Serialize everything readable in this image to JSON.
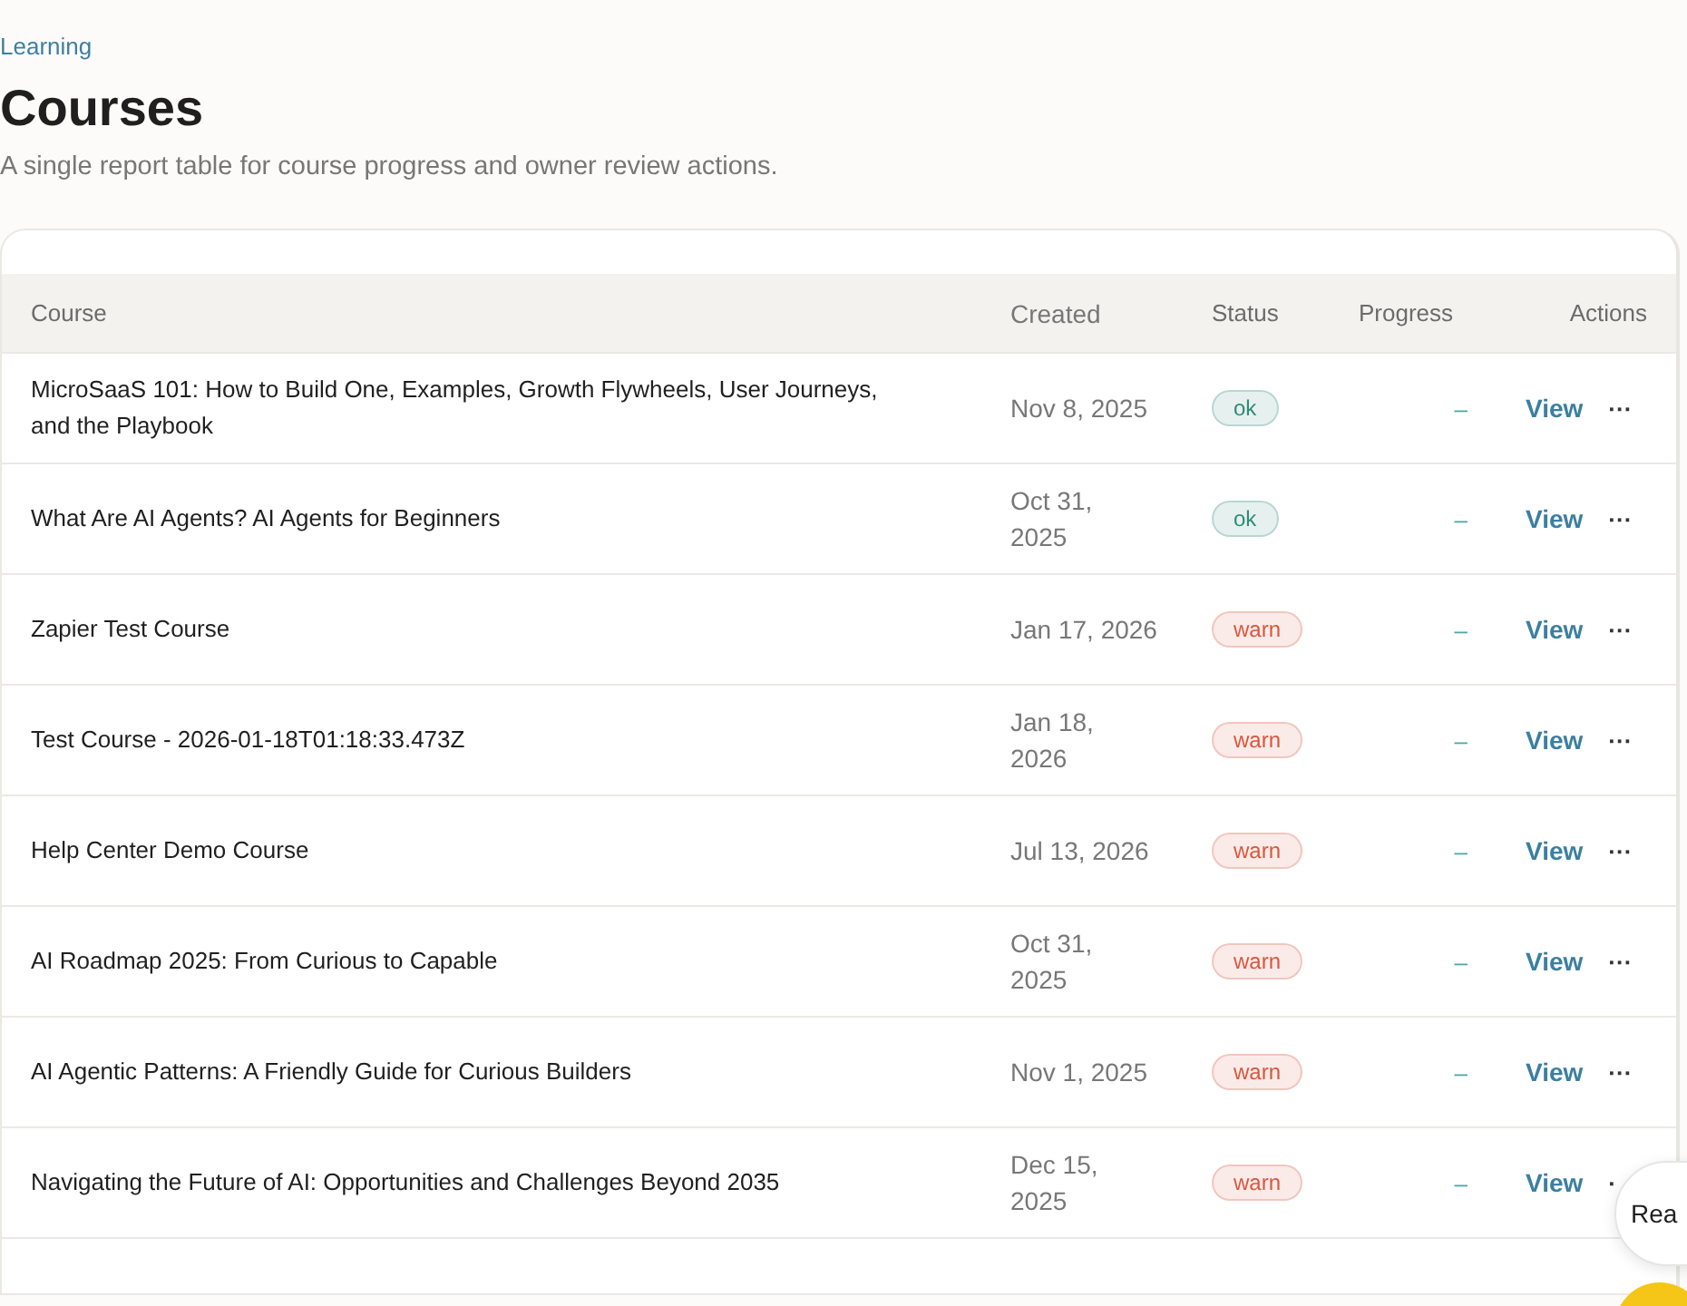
{
  "breadcrumb": "Learning",
  "title": "Courses",
  "subtitle": "A single report table for course progress and owner review actions.",
  "table": {
    "columns": [
      "Course",
      "Created",
      "Status",
      "Progress",
      "Actions"
    ],
    "rows": [
      {
        "course": "MicroSaaS 101: How to Build One, Examples, Growth Flywheels, User Journeys, and the Playbook",
        "created": [
          "Nov 8, 2025"
        ],
        "status": {
          "label": "ok",
          "color": "#2f8c78"
        },
        "progress": "–",
        "view": "View",
        "more": "···"
      },
      {
        "course": "What Are AI Agents? AI Agents for Beginners",
        "created": [
          "Oct 31,",
          "2025"
        ],
        "status": {
          "label": "ok",
          "color": "#2f8c78"
        },
        "progress": "–",
        "view": "View",
        "more": "···"
      },
      {
        "course": "Zapier Test Course",
        "created": [
          "Jan 17, 2026"
        ],
        "status": {
          "label": "warn",
          "color": "#d9573e"
        },
        "progress": "–",
        "view": "View",
        "more": "···"
      },
      {
        "course": "Test Course - 2026-01-18T01:18:33.473Z",
        "created": [
          "Jan 18,",
          "2026"
        ],
        "status": {
          "label": "warn",
          "color": "#d9573e"
        },
        "progress": "–",
        "view": "View",
        "more": "···"
      },
      {
        "course": "Help Center Demo Course",
        "created": [
          "Jul 13, 2026"
        ],
        "status": {
          "label": "warn",
          "color": "#d9573e"
        },
        "progress": "–",
        "view": "View",
        "more": "···"
      },
      {
        "course": "AI Roadmap 2025: From Curious to Capable",
        "created": [
          "Oct 31,",
          "2025"
        ],
        "status": {
          "label": "warn",
          "color": "#d9573e"
        },
        "progress": "–",
        "view": "View",
        "more": "···"
      },
      {
        "course": "AI Agentic Patterns: A Friendly Guide for Curious Builders",
        "created": [
          "Nov 1, 2025"
        ],
        "status": {
          "label": "warn",
          "color": "#d9573e"
        },
        "progress": "–",
        "view": "View",
        "more": "···"
      },
      {
        "course": "Navigating the Future of AI: Opportunities and Challenges Beyond 2035",
        "created": [
          "Dec 15,",
          "2025"
        ],
        "status": {
          "label": "warn",
          "color": "#d9573e"
        },
        "progress": "–",
        "view": "View",
        "more": "·"
      }
    ]
  },
  "floating_button": "Rea"
}
